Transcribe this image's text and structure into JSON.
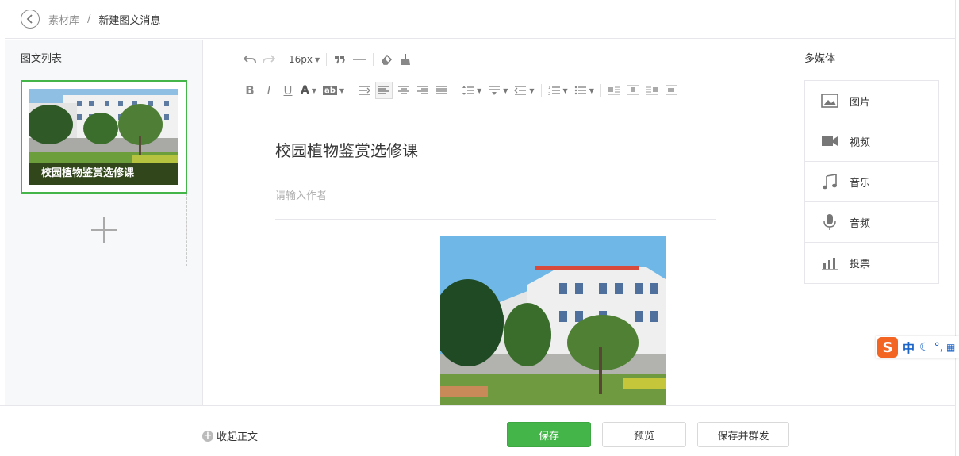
{
  "breadcrumb": {
    "root": "素材库",
    "separator": "/",
    "current": "新建图文消息"
  },
  "left_panel": {
    "title": "图文列表",
    "articles": [
      {
        "caption": "校园植物鉴赏选修课"
      }
    ],
    "add_symbol": "+"
  },
  "toolbar": {
    "font_size": "16px",
    "format_labels": {
      "bold": "B",
      "italic": "I",
      "underline": "U",
      "font_color": "A",
      "bg_color": "ab"
    }
  },
  "editor": {
    "title": "校园植物鉴赏选修课",
    "author_placeholder": "请输入作者"
  },
  "right_panel": {
    "title": "多媒体",
    "items": [
      {
        "label": "图片",
        "icon": "image-icon"
      },
      {
        "label": "视频",
        "icon": "video-icon"
      },
      {
        "label": "音乐",
        "icon": "music-icon"
      },
      {
        "label": "音频",
        "icon": "microphone-icon"
      },
      {
        "label": "投票",
        "icon": "vote-chart-icon"
      }
    ]
  },
  "ime": {
    "logo": "S",
    "mode": "中"
  },
  "bottom_bar": {
    "collapse_label": "收起正文",
    "save_label": "保存",
    "preview_label": "预览",
    "publish_label": "保存并群发"
  },
  "colors": {
    "accent": "#44b549",
    "border": "#e7e7eb",
    "panel_bg": "#f6f8f9"
  }
}
